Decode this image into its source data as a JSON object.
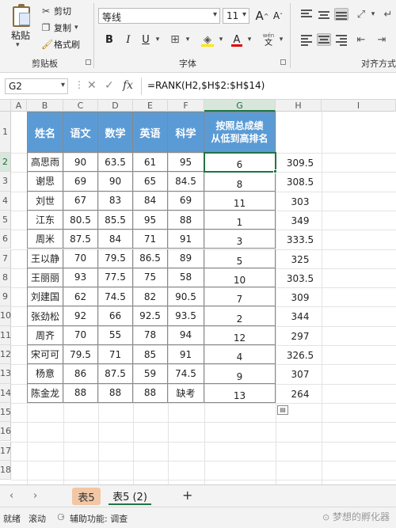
{
  "ribbon": {
    "paste_label": "粘贴",
    "cut_label": "剪切",
    "copy_label": "复制",
    "format_painter_label": "格式刷",
    "clipboard_group": "剪贴板",
    "font_group": "字体",
    "alignment_group": "对齐方式",
    "font_name": "等线",
    "font_size": "11",
    "bold": "B",
    "italic": "I",
    "underline": "U",
    "font_color_letter": "A",
    "grow_font": "A",
    "shrink_font": "A",
    "wen_top": "wén",
    "wen_bottom": "文",
    "accent_color": "#217346",
    "highlight_color": "#ffe600",
    "font_color": "#e00000"
  },
  "formula_bar": {
    "cell_ref": "G2",
    "cancel_glyph": "✕",
    "confirm_glyph": "✓",
    "fx_glyph": "fx",
    "formula": "=RANK(H2,$H$2:$H$14)"
  },
  "columns": [
    "A",
    "B",
    "C",
    "D",
    "E",
    "F",
    "G",
    "H",
    "I"
  ],
  "rows": [
    "1",
    "2",
    "3",
    "4",
    "5",
    "6",
    "7",
    "8",
    "9",
    "10",
    "11",
    "12",
    "13",
    "14",
    "15",
    "16",
    "17",
    "18"
  ],
  "table": {
    "headers": [
      "姓名",
      "语文",
      "数学",
      "英语",
      "科学"
    ],
    "rank_header_line1": "按照总成绩",
    "rank_header_line2": "从低到高排名",
    "rows": [
      [
        "高思雨",
        "90",
        "63.5",
        "61",
        "95",
        "6",
        "309.5"
      ],
      [
        "谢思",
        "69",
        "90",
        "65",
        "84.5",
        "8",
        "308.5"
      ],
      [
        "刘世",
        "67",
        "83",
        "84",
        "69",
        "11",
        "303"
      ],
      [
        "江东",
        "80.5",
        "85.5",
        "95",
        "88",
        "1",
        "349"
      ],
      [
        "周米",
        "87.5",
        "84",
        "71",
        "91",
        "3",
        "333.5"
      ],
      [
        "王以静",
        "70",
        "79.5",
        "86.5",
        "89",
        "5",
        "325"
      ],
      [
        "王丽丽",
        "93",
        "77.5",
        "75",
        "58",
        "10",
        "303.5"
      ],
      [
        "刘建国",
        "62",
        "74.5",
        "82",
        "90.5",
        "7",
        "309"
      ],
      [
        "张劲松",
        "92",
        "66",
        "92.5",
        "93.5",
        "2",
        "344"
      ],
      [
        "周齐",
        "70",
        "55",
        "78",
        "94",
        "12",
        "297"
      ],
      [
        "宋可可",
        "79.5",
        "71",
        "85",
        "91",
        "4",
        "326.5"
      ],
      [
        "杨意",
        "86",
        "87.5",
        "59",
        "74.5",
        "9",
        "307"
      ],
      [
        "陈金龙",
        "88",
        "88",
        "88",
        "缺考",
        "13",
        "264"
      ]
    ]
  },
  "sheets": {
    "tab1": "表5",
    "tab2": "表5 (2)",
    "add": "+",
    "prev": "‹",
    "next": "›"
  },
  "status": {
    "ready": "就绪",
    "scroll": "滚动",
    "accessibility": "辅助功能: 调查"
  },
  "watermark": "梦想的孵化器"
}
